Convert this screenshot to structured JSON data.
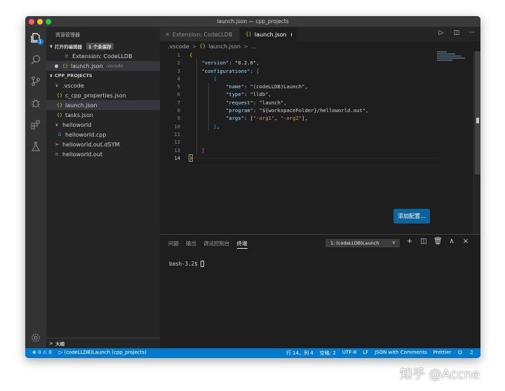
{
  "window": {
    "title": "launch.json — cpp_projects"
  },
  "activity_bar": {
    "explorer_badge": "1"
  },
  "sidebar": {
    "title": "资源管理器",
    "open_editors": {
      "label": "打开的编辑器",
      "badge": "1 个未保存",
      "items": [
        {
          "icon": "≡",
          "name": "Extension: CodeLLDB",
          "extra": ""
        },
        {
          "icon": "{}",
          "name": "launch.json",
          "extra": ".vscode"
        }
      ]
    },
    "project": {
      "label": "CPP_PROJECTS",
      "items": [
        {
          "chev": "∨",
          "icon": "",
          "name": ".vscode"
        },
        {
          "chev": "",
          "icon": "{}",
          "name": "c_cpp_properties.json"
        },
        {
          "chev": "",
          "icon": "{}",
          "name": "launch.json"
        },
        {
          "chev": "",
          "icon": "{}",
          "name": "tasks.json"
        },
        {
          "chev": "∨",
          "icon": "",
          "name": "helloworld"
        },
        {
          "chev": "",
          "icon": "G",
          "name": "helloworld.cpp"
        },
        {
          "chev": ">",
          "icon": "",
          "name": "helloworld.out.dSYM"
        },
        {
          "chev": "",
          "icon": "≡",
          "name": "helloworld.out"
        }
      ]
    },
    "outline_label": "大纲"
  },
  "tabs": [
    {
      "icon": "≡",
      "label": "Extension: CodeLLDB"
    },
    {
      "icon": "{}",
      "label": "launch.json"
    }
  ],
  "tab_actions": [
    "run-icon",
    "split-editor-icon",
    "more-icon"
  ],
  "breadcrumb": {
    "folder": ".vscode",
    "file_icon": "{}",
    "file": "launch.json",
    "tail": "..."
  },
  "editor": {
    "line_numbers": [
      "1",
      "2",
      "3",
      "4",
      "5",
      "6",
      "7",
      "8",
      "9",
      "10",
      "11",
      "12",
      "13",
      "14"
    ],
    "code": [
      "{",
      "    \"version\": \"0.2.0\",",
      "    \"configurations\": [",
      "        {",
      "            \"name\": \"(codeLLDB)Launch\",",
      "            \"type\": \"lldb\",",
      "            \"request\": \"launch\",",
      "            \"program\": \"${workspaceFolder}/helloworld.out\",",
      "            \"args\": [\"-arg1\", \"-arg2\"],",
      "        },",
      "",
      "",
      "    ]",
      "}"
    ],
    "add_config_button": "添加配置..."
  },
  "panel": {
    "tabs": [
      "问题",
      "输出",
      "调试控制台",
      "终端"
    ],
    "active_tab": "终端",
    "terminal_select": "1: (codeLLDB)Launch",
    "prompt": "bash-3.2$"
  },
  "statusbar": {
    "problems": "⊗ 0 ⚠ 0",
    "debug": "▷ (codeLLDB)Launch (cpp_projects)",
    "position": "行 14，列 4",
    "spaces": "空格: 2",
    "encoding": "UTF-8",
    "eol": "LF",
    "language": "JSON with Comments",
    "formatter": "Prettier"
  },
  "watermark": "知乎 @Accne",
  "colors": {
    "accent": "#007acc",
    "button": "#0e639c",
    "json_icon": "#cbcb41"
  }
}
